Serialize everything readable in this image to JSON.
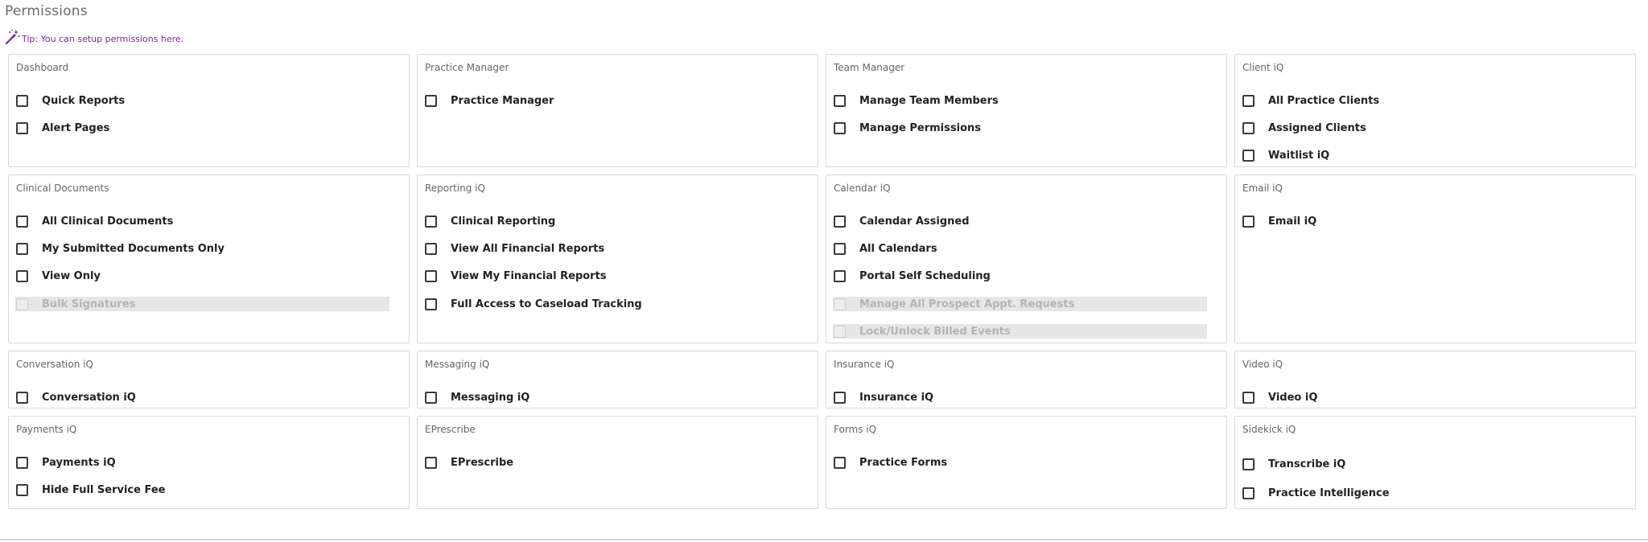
{
  "page": {
    "title": "Permissions",
    "tip": "Tip: You can setup permissions here."
  },
  "icons": {
    "tip": "magic-wand-icon",
    "checkbox": "checkbox-unchecked-icon"
  },
  "colors": {
    "tip": "#7b2a8f",
    "border": "#d9d9d9",
    "disabled_bg": "#e6e6e6"
  },
  "sections": [
    {
      "title": "Dashboard",
      "items": [
        {
          "label": "Quick Reports",
          "checked": false,
          "disabled": false
        },
        {
          "label": "Alert Pages",
          "checked": false,
          "disabled": false
        }
      ]
    },
    {
      "title": "Practice Manager",
      "items": [
        {
          "label": "Practice Manager",
          "checked": false,
          "disabled": false
        }
      ]
    },
    {
      "title": "Team Manager",
      "items": [
        {
          "label": "Manage Team Members",
          "checked": false,
          "disabled": false
        },
        {
          "label": "Manage Permissions",
          "checked": false,
          "disabled": false
        }
      ]
    },
    {
      "title": "Client iQ",
      "items": [
        {
          "label": "All Practice Clients",
          "checked": false,
          "disabled": false
        },
        {
          "label": "Assigned Clients",
          "checked": false,
          "disabled": false
        },
        {
          "label": "Waitlist iQ",
          "checked": false,
          "disabled": false
        }
      ]
    },
    {
      "title": "Clinical Documents",
      "items": [
        {
          "label": "All Clinical Documents",
          "checked": false,
          "disabled": false
        },
        {
          "label": "My Submitted Documents Only",
          "checked": false,
          "disabled": false
        },
        {
          "label": "View Only",
          "checked": false,
          "disabled": false
        },
        {
          "label": "Bulk Signatures",
          "checked": false,
          "disabled": true
        }
      ]
    },
    {
      "title": "Reporting iQ",
      "items": [
        {
          "label": "Clinical Reporting",
          "checked": false,
          "disabled": false
        },
        {
          "label": "View All Financial Reports",
          "checked": false,
          "disabled": false
        },
        {
          "label": "View My Financial Reports",
          "checked": false,
          "disabled": false
        },
        {
          "label": "Full Access to Caseload Tracking",
          "checked": false,
          "disabled": false
        }
      ]
    },
    {
      "title": "Calendar iQ",
      "items": [
        {
          "label": "Calendar Assigned",
          "checked": false,
          "disabled": false
        },
        {
          "label": "All Calendars",
          "checked": false,
          "disabled": false
        },
        {
          "label": "Portal Self Scheduling",
          "checked": false,
          "disabled": false
        },
        {
          "label": "Manage All Prospect Appt. Requests",
          "checked": false,
          "disabled": true
        },
        {
          "label": "Lock/Unlock Billed Events",
          "checked": false,
          "disabled": true
        }
      ]
    },
    {
      "title": "Email iQ",
      "items": [
        {
          "label": "Email iQ",
          "checked": false,
          "disabled": false
        }
      ]
    },
    {
      "title": "Conversation iQ",
      "items": [
        {
          "label": "Conversation iQ",
          "checked": false,
          "disabled": false
        }
      ]
    },
    {
      "title": "Messaging iQ",
      "items": [
        {
          "label": "Messaging iQ",
          "checked": false,
          "disabled": false
        }
      ]
    },
    {
      "title": "Insurance iQ",
      "items": [
        {
          "label": "Insurance iQ",
          "checked": false,
          "disabled": false
        }
      ]
    },
    {
      "title": "Video iQ",
      "items": [
        {
          "label": "Video iQ",
          "checked": false,
          "disabled": false
        }
      ]
    },
    {
      "title": "Payments iQ",
      "items": [
        {
          "label": "Payments iQ",
          "checked": false,
          "disabled": false
        },
        {
          "label": "Hide Full Service Fee",
          "checked": false,
          "disabled": false
        }
      ]
    },
    {
      "title": "EPrescribe",
      "items": [
        {
          "label": "EPrescribe",
          "checked": false,
          "disabled": false
        }
      ]
    },
    {
      "title": "Forms iQ",
      "items": [
        {
          "label": "Practice Forms",
          "checked": false,
          "disabled": false
        }
      ]
    },
    {
      "title": "Sidekick iQ",
      "items": [
        {
          "label": "Transcribe iQ",
          "checked": false,
          "disabled": false
        },
        {
          "label": "Practice Intelligence",
          "checked": false,
          "disabled": false
        }
      ]
    }
  ]
}
